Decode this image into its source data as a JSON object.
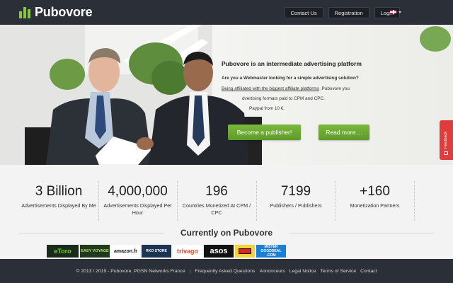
{
  "header": {
    "logo_text": "Pubovore",
    "nav": [
      "Contact Us",
      "Registration",
      "Login"
    ],
    "language_flag": "uk-flag-icon"
  },
  "hero": {
    "title": "Pubovore is an intermediate advertising platform",
    "question": "Are you a Webmaster looking for a simple advertising solution?",
    "line2_link": "Being affiliated with the biggest affiliate platforms",
    "line2_rest": " ,Pubovore you",
    "line3": "dvertising formats paid to CPM and CPC.",
    "line4": "Paypal from 10 €.",
    "btn_publisher": "Become a publisher!",
    "btn_readmore": "Read more ..."
  },
  "feedback": {
    "label": "Feedback"
  },
  "stats": [
    {
      "value": "3 Billion",
      "label": "Advertisements Displayed By Me"
    },
    {
      "value": "4,000,000",
      "label": "Advertisements Displayed Per Hour"
    },
    {
      "value": "196",
      "label": "Countries Monetized At CPM / CPC"
    },
    {
      "value": "7199",
      "label": "Publishers / Publishers"
    },
    {
      "value": "+160",
      "label": "Monetization Partners"
    }
  ],
  "currently": {
    "title": "Currently on Pubovore",
    "partners": [
      "eToro",
      "EASY VOYAGE",
      "amazon.fr",
      "RKO STORE",
      "trivago",
      "asos",
      "",
      "MISTER GOODDEAL .COM"
    ]
  },
  "footer": {
    "copyright": "© 2013 / 2019 - Pubovore, PGSN Networks France",
    "sep": "|",
    "links": [
      "Frequently Asked Questions",
      "Annonceurs",
      "Legal Notice",
      "Terms of Service",
      "Contact"
    ]
  },
  "colors": {
    "header_bg": "#2b3038",
    "accent_green": "#6aaa34",
    "feedback_red": "#e23b3b"
  }
}
